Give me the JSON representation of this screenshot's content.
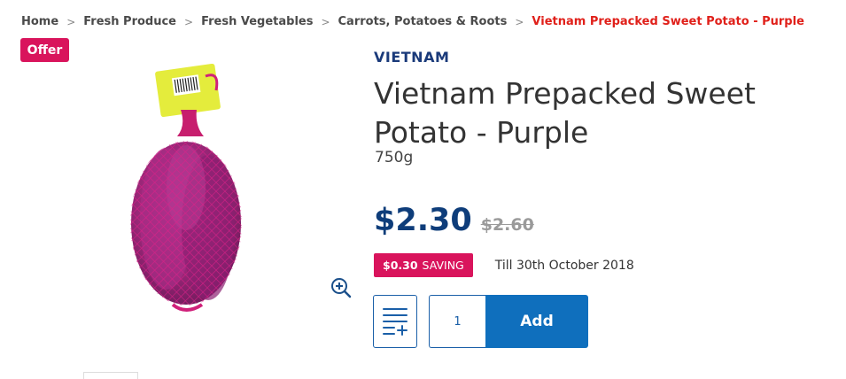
{
  "breadcrumb": {
    "home": "Home",
    "level1": "Fresh Produce",
    "level2": "Fresh Vegetables",
    "level3": "Carrots, Potatoes & Roots",
    "current": "Vietnam Prepacked Sweet Potato - Purple",
    "separator": ">"
  },
  "badge": {
    "label": "Offer"
  },
  "product": {
    "origin": "VIETNAM",
    "title": "Vietnam Prepacked Sweet Potato - Purple",
    "size": "750g",
    "price_now": "$2.30",
    "price_was": "$2.60",
    "saving_amount": "$0.30",
    "saving_label": "SAVING",
    "saving_until": "Till 30th October 2018"
  },
  "cart": {
    "quantity": "1",
    "add_label": "Add"
  },
  "icons": {
    "zoom": "zoom-in-icon",
    "list": "add-to-list-icon"
  },
  "colors": {
    "offer": "#d9145c",
    "price": "#0e3d7a",
    "accent": "#0f6fbd",
    "breadcrumb_current": "#e0201a"
  }
}
